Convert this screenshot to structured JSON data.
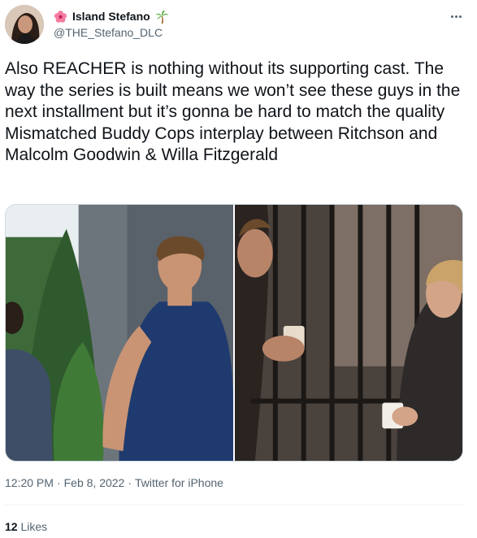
{
  "author": {
    "display_name": "Island Stefano",
    "handle": "@THE_Stefano_DLC",
    "name_emoji_left": "hibiscus-icon",
    "name_emoji_right": "palm-tree-icon"
  },
  "tweet": {
    "text": "Also REACHER is nothing without its supporting cast. The way the series is built means we won’t see these guys in the next installment but it’s gonna be hard to match the quality Mismatched Buddy Cops interplay between Ritchson and Malcolm Goodwin & Willa Fitzgerald",
    "time": "12:20 PM",
    "date": "Feb 8, 2022",
    "source": "Twitter for iPhone",
    "separator": "·"
  },
  "stats": {
    "likes_count": "12",
    "likes_label": "Likes"
  },
  "colors": {
    "text_primary": "#0f1419",
    "text_secondary": "#536471",
    "border": "#cfd9de"
  }
}
